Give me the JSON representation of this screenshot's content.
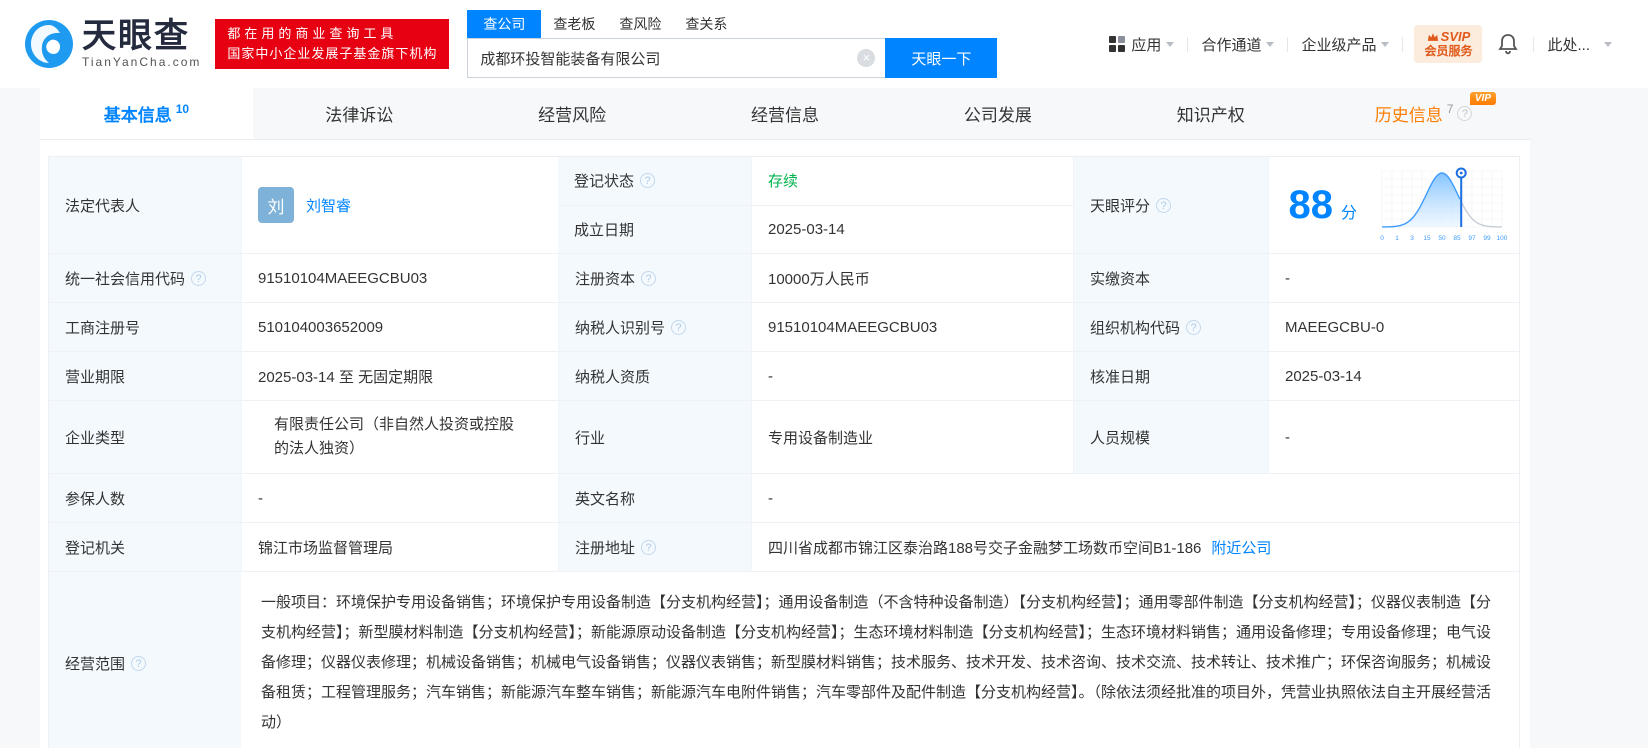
{
  "header": {
    "brand": "天眼查",
    "brand_domain": "TianYanCha.com",
    "slogan_line1": "都在用的商业查询工具",
    "slogan_line2": "国家中小企业发展子基金旗下机构",
    "search": {
      "tabs": [
        {
          "label": "查公司",
          "active": true
        },
        {
          "label": "查老板",
          "active": false
        },
        {
          "label": "查风险",
          "active": false
        },
        {
          "label": "查关系",
          "active": false
        }
      ],
      "value": "成都环投智能装备有限公司",
      "clear_icon": "×",
      "button": "天眼一下"
    },
    "nav": {
      "app": "应用",
      "partner": "合作通道",
      "enterprise": "企业级产品",
      "svip_top": "SVIP",
      "svip_bottom": "会员服务",
      "more": "此处..."
    }
  },
  "tabs": [
    {
      "label": "基本信息",
      "count": "10"
    },
    {
      "label": "法律诉讼"
    },
    {
      "label": "经营风险"
    },
    {
      "label": "经营信息"
    },
    {
      "label": "公司发展"
    },
    {
      "label": "知识产权"
    },
    {
      "label": "历史信息",
      "count": "7",
      "vip": "VIP"
    }
  ],
  "profile": {
    "legal_rep": {
      "label": "法定代表人",
      "avatar": "刘",
      "name": "刘智睿"
    },
    "reg_status": {
      "label": "登记状态",
      "value": "存续"
    },
    "est_date": {
      "label": "成立日期",
      "value": "2025-03-14"
    },
    "score": {
      "label": "天眼评分",
      "value": "88",
      "unit": "分"
    },
    "uscc": {
      "label": "统一社会信用代码",
      "value": "91510104MAEEGCBU03"
    },
    "reg_capital": {
      "label": "注册资本",
      "value": "10000万人民币"
    },
    "paid_capital": {
      "label": "实缴资本",
      "value": "-"
    },
    "reg_no": {
      "label": "工商注册号",
      "value": "510104003652009"
    },
    "taxpayer_id": {
      "label": "纳税人识别号",
      "value": "91510104MAEEGCBU03"
    },
    "org_code": {
      "label": "组织机构代码",
      "value": "MAEEGCBU-0"
    },
    "term": {
      "label": "营业期限",
      "value": "2025-03-14 至 无固定期限"
    },
    "taxpayer_qual": {
      "label": "纳税人资质",
      "value": "-"
    },
    "approval_date": {
      "label": "核准日期",
      "value": "2025-03-14"
    },
    "company_type": {
      "label": "企业类型",
      "value": "有限责任公司（非自然人投资或控股的法人独资）"
    },
    "industry": {
      "label": "行业",
      "value": "专用设备制造业"
    },
    "staff": {
      "label": "人员规模",
      "value": "-"
    },
    "insured": {
      "label": "参保人数",
      "value": "-"
    },
    "en_name": {
      "label": "英文名称",
      "value": "-"
    },
    "authority": {
      "label": "登记机关",
      "value": "锦江市场监督管理局"
    },
    "address": {
      "label": "注册地址",
      "value": "四川省成都市锦江区泰治路188号交子金融梦工场数币空间B1-186",
      "nearby": "附近公司"
    },
    "scope": {
      "label": "经营范围",
      "value": "一般项目：环境保护专用设备销售；环境保护专用设备制造【分支机构经营】；通用设备制造（不含特种设备制造）【分支机构经营】；通用零部件制造【分支机构经营】；仪器仪表制造【分支机构经营】；新型膜材料制造【分支机构经营】；新能源原动设备制造【分支机构经营】；生态环境材料制造【分支机构经营】；生态环境材料销售；通用设备修理；专用设备修理；电气设备修理；仪器仪表修理；机械设备销售；机械电气设备销售；仪器仪表销售；新型膜材料销售；技术服务、技术开发、技术咨询、技术交流、技术转让、技术推广；环保咨询服务；机械设备租赁；工程管理服务；汽车销售；新能源汽车整车销售；新能源汽车电附件销售；汽车零部件及配件制造【分支机构经营】。（除依法须经批准的项目外，凭营业执照依法自主开展经营活动）"
    }
  },
  "chart_data": {
    "type": "area",
    "title": "天眼评分",
    "score": 88,
    "x_ticks": [
      "0",
      "1",
      "3",
      "15",
      "50",
      "85",
      "97",
      "99",
      "100"
    ],
    "marker_position": 0.66,
    "peak_position": 0.5,
    "sigma": 0.13,
    "grid": true,
    "colors": {
      "curve": "#3d9bff",
      "fill_top": "#7cc0ff",
      "fill_bottom": "#e3f1ff",
      "inactive": "#c5cdd6",
      "marker": "#1b6fe0",
      "tick_text": "#3d9bff",
      "grid_line": "#edf1f6"
    }
  }
}
